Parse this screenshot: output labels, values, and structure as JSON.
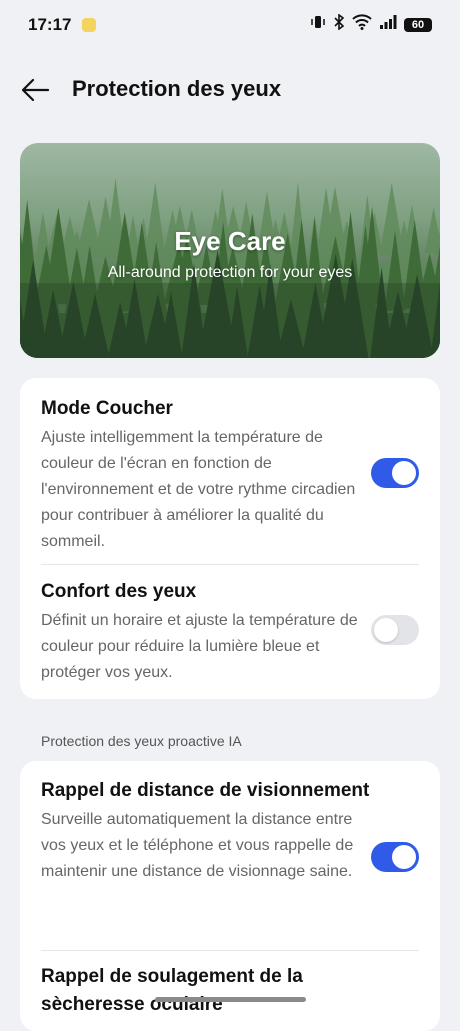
{
  "status_bar": {
    "time": "17:17",
    "battery": "60"
  },
  "header": {
    "title": "Protection des yeux",
    "back_icon": "arrow-left-icon"
  },
  "banner": {
    "title": "Eye Care",
    "subtitle": "All-around protection for your eyes"
  },
  "settings": [
    {
      "title": "Mode Coucher",
      "description": "Ajuste intelligemment la température de couleur de l'écran en fonction de l'environnement et de votre rythme circadien pour contribuer à améliorer la qualité du sommeil.",
      "enabled": true
    },
    {
      "title": "Confort des yeux",
      "description": "Définit un horaire et ajuste la température de couleur pour réduire la lumière bleue et protéger vos yeux.",
      "enabled": false
    }
  ],
  "ai_section": {
    "label": "Protection des yeux proactive IA",
    "settings": [
      {
        "title": "Rappel de distance de visionnement",
        "description": "Surveille automatiquement la distance entre vos yeux et le téléphone et vous rappelle de maintenir une distance de visionnage saine.",
        "enabled": true
      },
      {
        "title": "Rappel de soulagement de la sècheresse oculaire",
        "description": "",
        "enabled": false
      }
    ]
  },
  "colors": {
    "accent": "#2f5be8",
    "background": "#f0f1f5",
    "card": "#ffffff"
  }
}
